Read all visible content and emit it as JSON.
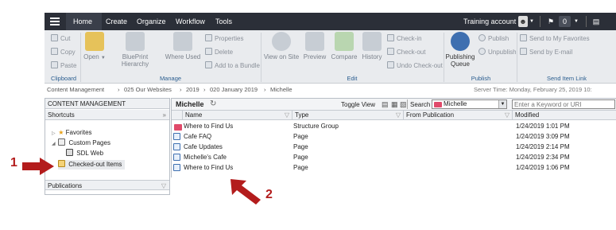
{
  "topbar": {
    "menu": [
      "Home",
      "Create",
      "Organize",
      "Workflow",
      "Tools"
    ],
    "account": "Training account",
    "notif_count": "0"
  },
  "ribbon": {
    "clipboard": {
      "cut": "Cut",
      "copy": "Copy",
      "paste": "Paste",
      "label": "Clipboard"
    },
    "manage": {
      "open": "Open",
      "blueprint": "BluePrint Hierarchy",
      "where_used": "Where Used",
      "properties": "Properties",
      "delete": "Delete",
      "add_bundle": "Add to a Bundle",
      "label": "Manage"
    },
    "edit": {
      "view_on_site": "View on Site",
      "preview": "Preview",
      "compare": "Compare",
      "history": "History",
      "check_in": "Check-in",
      "check_out": "Check-out",
      "undo_check_out": "Undo Check-out",
      "label": "Edit"
    },
    "publish": {
      "queue": "Publishing Queue",
      "publish": "Publish",
      "unpublish": "Unpublish",
      "label": "Publish"
    },
    "send": {
      "favorites": "Send to My Favorites",
      "email": "Send by E-mail",
      "label": "Send Item Link"
    }
  },
  "breadcrumb": {
    "items": [
      "Content Management",
      "025 Our Websites",
      "2019",
      "020 January 2019",
      "Michelle"
    ],
    "server_time": "Server Time: Monday, February 25, 2019 10:"
  },
  "leftpanel": {
    "header": "CONTENT MANAGEMENT",
    "shortcuts": "Shortcuts",
    "tree": [
      "Favorites",
      "Custom Pages",
      "SDL Web",
      "Checked-out Items"
    ],
    "publications": "Publications"
  },
  "list": {
    "title": "Michelle",
    "toggle_view": "Toggle View",
    "search_label": "Search",
    "search_scope": "Michelle",
    "search_placeholder": "Enter a Keyword or URI",
    "columns": [
      "Name",
      "Type",
      "From Publication",
      "Modified"
    ],
    "rows": [
      {
        "name": "Where to Find Us",
        "type": "Structure Group",
        "from": "",
        "modified": "1/24/2019 1:01 PM",
        "icon": "folder"
      },
      {
        "name": "Cafe FAQ",
        "type": "Page",
        "from": "",
        "modified": "1/24/2019 3:09 PM",
        "icon": "page"
      },
      {
        "name": "Cafe Updates",
        "type": "Page",
        "from": "",
        "modified": "1/24/2019 2:14 PM",
        "icon": "page"
      },
      {
        "name": "Michelle's Cafe",
        "type": "Page",
        "from": "",
        "modified": "1/24/2019 2:34 PM",
        "icon": "page"
      },
      {
        "name": "Where to Find Us",
        "type": "Page",
        "from": "",
        "modified": "1/24/2019 1:06 PM",
        "icon": "page"
      }
    ]
  },
  "annotations": {
    "one": "1",
    "two": "2"
  },
  "colors": {
    "topbar": "#2b2f38",
    "arrow": "#b31c1c",
    "folder": "#e04a6a",
    "page": "#3e6fb0"
  }
}
